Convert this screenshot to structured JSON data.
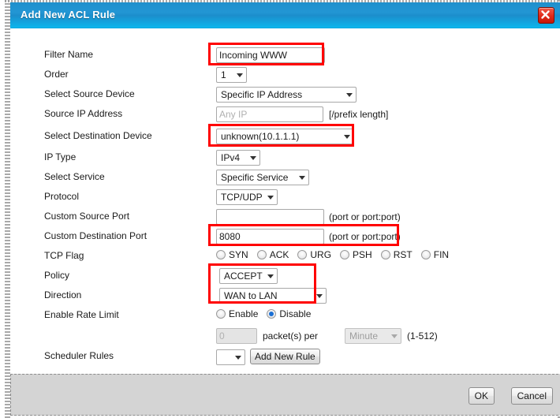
{
  "dialog": {
    "title": "Add New ACL Rule",
    "close_icon": "close-icon",
    "accent_color": "#1f8fcc",
    "highlight_color": "#ff0000"
  },
  "form": {
    "filter_name": {
      "label": "Filter Name",
      "value": "Incoming WWW",
      "placeholder": "",
      "highlighted": true
    },
    "order": {
      "label": "Order",
      "value": "1",
      "highlighted": false
    },
    "select_source_device": {
      "label": "Select Source Device",
      "value": "Specific IP Address",
      "highlighted": false
    },
    "source_ip_address": {
      "label": "Source IP Address",
      "value": "",
      "placeholder": "Any IP",
      "suffix": "[/prefix length]",
      "highlighted": false
    },
    "select_destination_device": {
      "label": "Select Destination Device",
      "value": "unknown(10.1.1.1)",
      "highlighted": true
    },
    "ip_type": {
      "label": "IP Type",
      "value": "IPv4",
      "highlighted": false
    },
    "select_service": {
      "label": "Select Service",
      "value": "Specific Service",
      "highlighted": false
    },
    "protocol": {
      "label": "Protocol",
      "value": "TCP/UDP",
      "highlighted": false
    },
    "custom_source_port": {
      "label": "Custom Source Port",
      "value": "",
      "placeholder": "",
      "suffix": "(port or port:port)",
      "highlighted": false
    },
    "custom_destination_port": {
      "label": "Custom Destination Port",
      "value": "8080",
      "placeholder": "",
      "suffix": "(port or port:port)",
      "highlighted": true
    },
    "tcp_flag": {
      "label": "TCP Flag",
      "options": [
        {
          "label": "SYN",
          "checked": false
        },
        {
          "label": "ACK",
          "checked": false
        },
        {
          "label": "URG",
          "checked": false
        },
        {
          "label": "PSH",
          "checked": false
        },
        {
          "label": "RST",
          "checked": false
        },
        {
          "label": "FIN",
          "checked": false
        }
      ]
    },
    "policy": {
      "label": "Policy",
      "value": "ACCEPT",
      "highlighted": true
    },
    "direction": {
      "label": "Direction",
      "value": "WAN to LAN",
      "highlighted": true
    },
    "enable_rate_limit": {
      "label": "Enable Rate Limit",
      "options": [
        {
          "label": "Enable",
          "checked": false
        },
        {
          "label": "Disable",
          "checked": true
        }
      ]
    },
    "rate_limit": {
      "value": "0",
      "placeholder": "0",
      "middle_text": "packet(s) per",
      "unit_value": "Minute",
      "range_text": "(1-512)",
      "disabled": true
    },
    "scheduler_rules": {
      "label": "Scheduler Rules",
      "value": "",
      "add_button_label": "Add New Rule"
    }
  },
  "footer": {
    "ok_label": "OK",
    "cancel_label": "Cancel"
  }
}
